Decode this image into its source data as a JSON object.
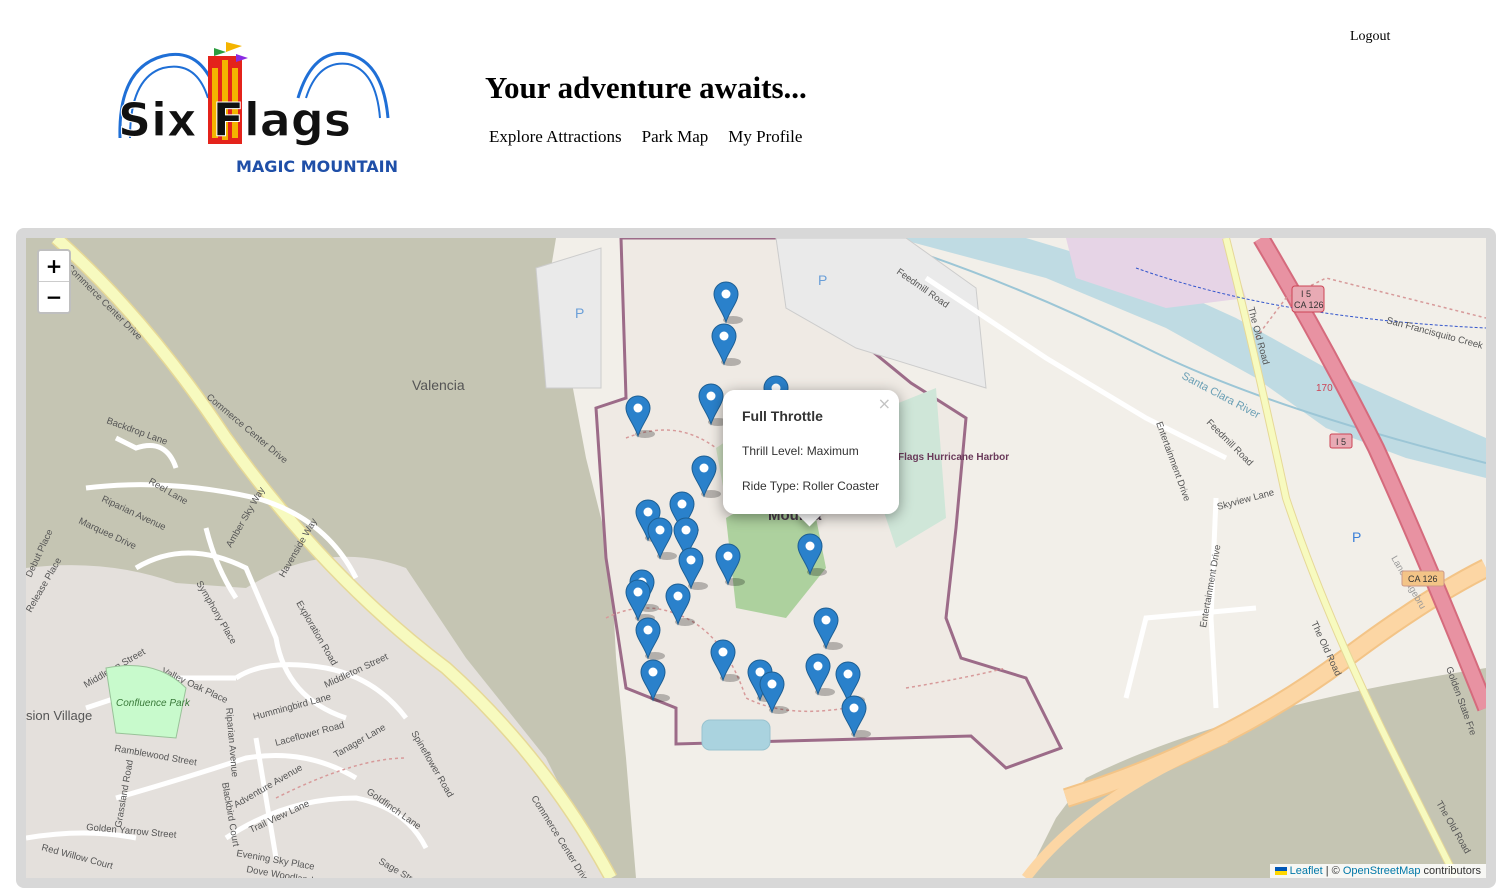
{
  "header": {
    "logo": {
      "line1": "Six Flags",
      "line2": "MAGIC MOUNTAIN"
    },
    "title": "Your adventure awaits...",
    "nav": [
      "Explore Attractions",
      "Park Map",
      "My Profile"
    ],
    "logout": "Logout"
  },
  "map": {
    "zoom_in": "+",
    "zoom_out": "−",
    "labels": {
      "commerce_center_drive": "Commerce Center Drive",
      "valencia": "Valencia",
      "backdrop_lane": "Backdrop Lane",
      "reel_lane": "Reel Lane",
      "riparian_avenue": "Riparian Avenue",
      "marquee_drive": "Marquee Drive",
      "debut_place": "Debut Place",
      "release_place": "Release Place",
      "amber_sky_way": "Amber Sky Way",
      "havenside_way": "Havenside Way",
      "symphony_place": "Symphony Place",
      "exploration_road": "Exploration Road",
      "middleton_street": "Middleton Street",
      "valley_oak_place": "Valley Oak Place",
      "confluence_park": "Confluence Park",
      "mission_village": "sion Village",
      "hummingbird_lane": "Hummingbird Lane",
      "laceflower_road": "Laceflower Road",
      "tanager_lane": "Tanager Lane",
      "spineflower_road": "Spineflower Road",
      "ramblewood_street": "Ramblewood Street",
      "adventure_avenue": "Adventure Avenue",
      "goldfinch_lane": "Goldfinch Lane",
      "trail_view_lane": "Trail View Lane",
      "golden_yarrow_street": "Golden Yarrow Street",
      "red_willow_court": "Red Willow Court",
      "evening_sky_place": "Evening Sky Place",
      "sage_street": "Sage Street",
      "dove_woodland": "Dove Woodland",
      "grassland_road": "Grassland Road",
      "blackbird_court": "Blackbird Court",
      "feedmill_road": "Feedmill Road",
      "the_old_road": "The Old Road",
      "i5": "I 5",
      "ca126": "CA 126",
      "exit170": "170",
      "san_francisquito": "San Francisquito Creek Tr",
      "santa_clara_river": "Santa Clara River",
      "entertainment_drive": "Entertainment Drive",
      "skyview_lane": "Skyview Lane",
      "golden_state_freeway": "Golden State Fre",
      "parking": "P",
      "park_name_fragment": "Mounta",
      "hurricane_harbor": "Flags Hurricane Harbor"
    },
    "attribution": {
      "leaflet": "Leaflet",
      "separator": " | © ",
      "osm": "OpenStreetMap",
      "suffix": " contributors"
    }
  },
  "popup": {
    "title": "Full Throttle",
    "thrill": "Thrill Level: Maximum",
    "ride_type": "Ride Type: Roller Coaster",
    "close": "×"
  },
  "colors": {
    "marker": "#2A81CB",
    "motorway": "#e892a2",
    "trunk": "#fcd6a4",
    "primary": "#f7fabf",
    "landuse_dark": "#c5c5b3",
    "park_boundary": "#9c6b88",
    "river": "#aad3df",
    "park_green": "#add19e"
  }
}
